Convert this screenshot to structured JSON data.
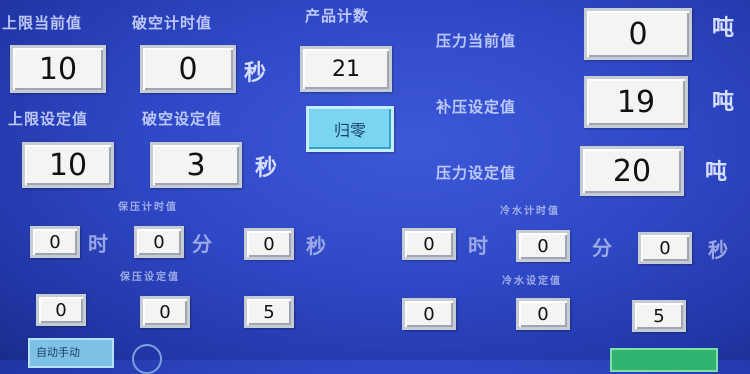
{
  "top_left": {
    "upper_current_label": "上限当前值",
    "upper_current_value": "10",
    "vacuum_timer_label": "破空计时值",
    "vacuum_timer_value": "0",
    "vacuum_timer_unit": "秒",
    "upper_setting_label": "上限设定值",
    "upper_setting_value": "10",
    "vacuum_setting_label": "破空设定值",
    "vacuum_setting_value": "3",
    "vacuum_setting_unit": "秒"
  },
  "counter": {
    "label": "产品计数",
    "value": "21",
    "reset_label": "归零"
  },
  "pressure": {
    "current_label": "压力当前值",
    "current_value": "0",
    "current_unit": "吨",
    "comp_label": "补压设定值",
    "comp_value": "19",
    "comp_unit": "吨",
    "setting_label": "压力设定值",
    "setting_value": "20",
    "setting_unit": "吨"
  },
  "hold_timer": {
    "label": "保压计时值",
    "hours": "0",
    "hours_unit": "时",
    "minutes": "0",
    "minutes_unit": "分",
    "seconds": "0",
    "seconds_unit": "秒"
  },
  "cool_timer": {
    "label": "冷水计时值",
    "hours": "0",
    "hours_unit": "时",
    "minutes": "0",
    "minutes_unit": "分",
    "seconds": "0",
    "seconds_unit": "秒"
  },
  "hold_setting": {
    "label": "保压设定值",
    "hours": "0",
    "minutes": "0",
    "seconds": "5"
  },
  "cool_setting": {
    "label": "冷水设定值",
    "hours": "0",
    "minutes": "0",
    "seconds": "5"
  },
  "bottom": {
    "left_button_label": "自动手动"
  }
}
